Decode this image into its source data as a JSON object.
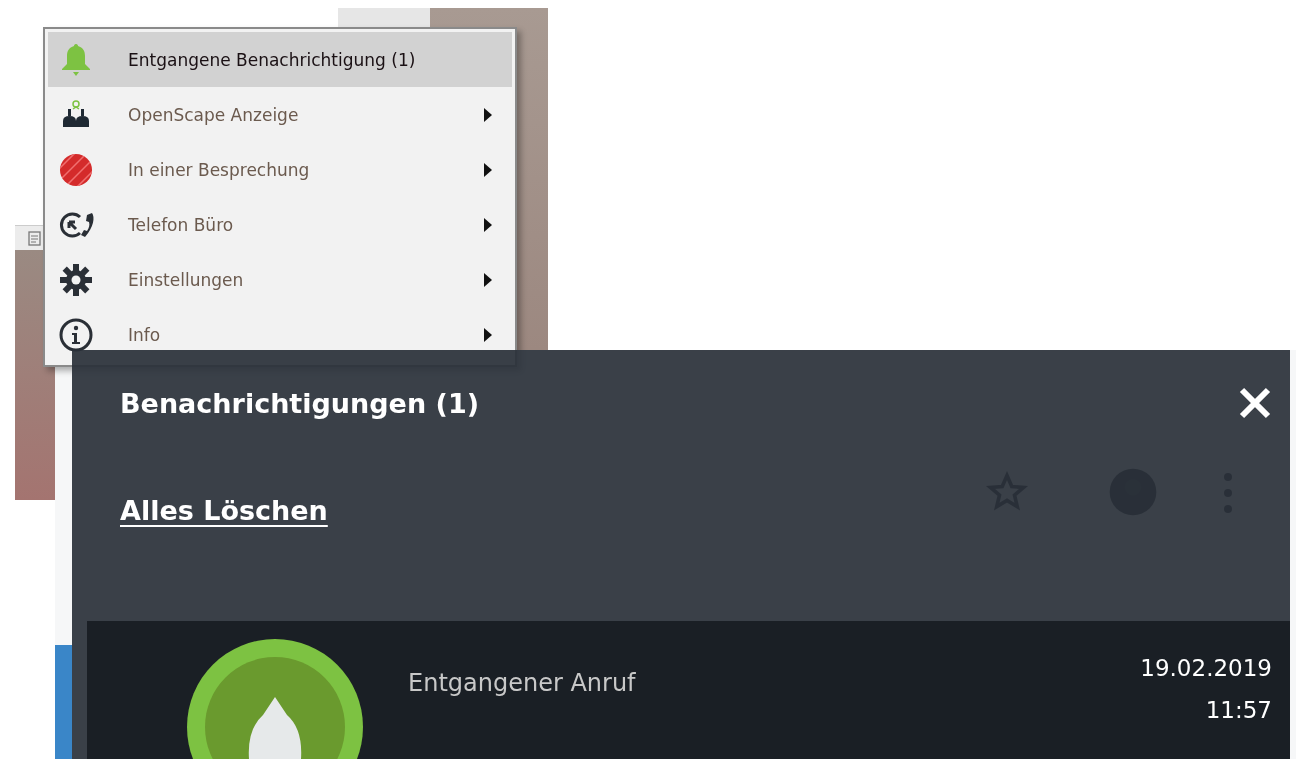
{
  "context_menu": {
    "items": [
      {
        "kind": "bell",
        "label": "Entgangene Benachrichtigung (1)",
        "selected": true,
        "submenu": false
      },
      {
        "kind": "people",
        "label": "OpenScape Anzeige",
        "selected": false,
        "submenu": true
      },
      {
        "kind": "busy",
        "label": "In einer Besprechung",
        "selected": false,
        "submenu": true
      },
      {
        "kind": "phone",
        "label": "Telefon Büro",
        "selected": false,
        "submenu": true
      },
      {
        "kind": "gear",
        "label": "Einstellungen",
        "selected": false,
        "submenu": true
      },
      {
        "kind": "info",
        "label": "Info",
        "selected": false,
        "submenu": true
      }
    ]
  },
  "notification_panel": {
    "title": "Benachrichtigungen (1)",
    "clear_all": "Alles Löschen",
    "notifications": [
      {
        "title": "Entgangener Anruf",
        "date": "19.02.2019",
        "time": "11:57"
      }
    ]
  }
}
